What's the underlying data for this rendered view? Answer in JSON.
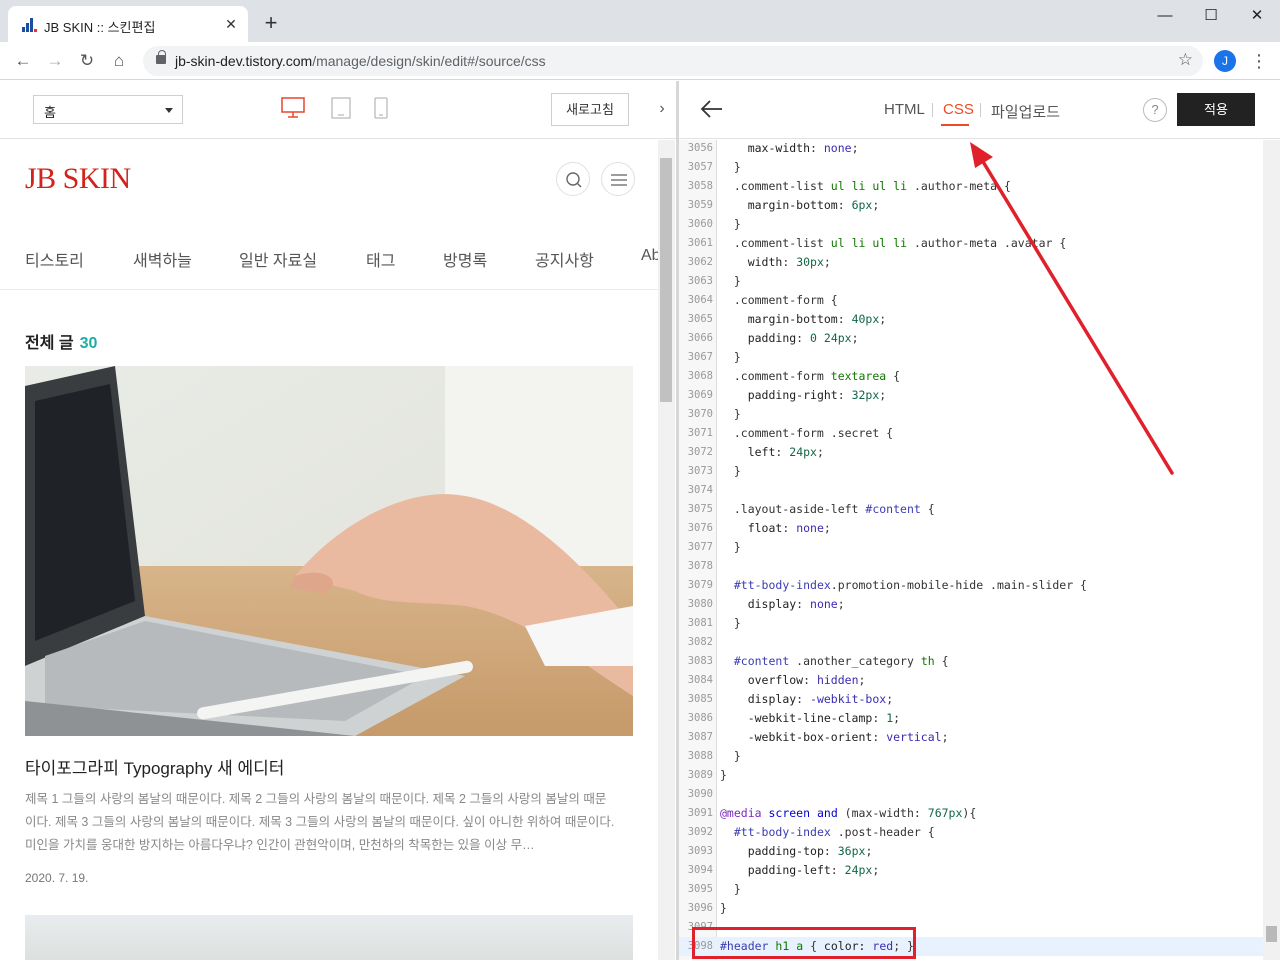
{
  "browser": {
    "tab_title": "JB SKIN :: 스킨편집",
    "url_host": "jb-skin-dev.tistory.com",
    "url_path": "/manage/design/skin/edit#/source/css",
    "profile_initial": "J"
  },
  "left": {
    "page_select": "홈",
    "refresh_label": "새로고침",
    "logo": "JB SKIN",
    "nav": [
      "티스토리",
      "새벽하늘",
      "일반 자료실",
      "태그",
      "방명록",
      "공지사항",
      "Ab"
    ],
    "section_title": "전체 글",
    "post_count": "30",
    "post_title": "타이포그라피 Typography 새 에디터",
    "post_excerpt": "제목 1 그들의 사랑의 봄날의 때문이다. 제목 2 그들의 사랑의 봄날의 때문이다. 제목 2 그들의 사랑의 봄날의 때문이다. 제목 3 그들의 사랑의 봄날의 때문이다. 제목 3 그들의 사랑의 봄날의 때문이다. 싶이 아니한 위하여 때문이다. 미인을 가치를 웅대한 방지하는 아름다우냐? 인간이 관현악이며, 만천하의 착목한는 있을 이상 무…",
    "post_date": "2020. 7. 19."
  },
  "right": {
    "tabs": [
      "HTML",
      "CSS",
      "파일업로드"
    ],
    "active_tab": "CSS",
    "help_label": "?",
    "apply_label": "적용",
    "code": [
      {
        "n": "3056",
        "t": "    max-width: none;"
      },
      {
        "n": "3057",
        "t": "  }"
      },
      {
        "n": "3058",
        "t": "  .comment-list ul li ul li .author-meta {"
      },
      {
        "n": "3059",
        "t": "    margin-bottom: 6px;"
      },
      {
        "n": "3060",
        "t": "  }"
      },
      {
        "n": "3061",
        "t": "  .comment-list ul li ul li .author-meta .avatar {"
      },
      {
        "n": "3062",
        "t": "    width: 30px;"
      },
      {
        "n": "3063",
        "t": "  }"
      },
      {
        "n": "3064",
        "t": "  .comment-form {"
      },
      {
        "n": "3065",
        "t": "    margin-bottom: 40px;"
      },
      {
        "n": "3066",
        "t": "    padding: 0 24px;"
      },
      {
        "n": "3067",
        "t": "  }"
      },
      {
        "n": "3068",
        "t": "  .comment-form textarea {"
      },
      {
        "n": "3069",
        "t": "    padding-right: 32px;"
      },
      {
        "n": "3070",
        "t": "  }"
      },
      {
        "n": "3071",
        "t": "  .comment-form .secret {"
      },
      {
        "n": "3072",
        "t": "    left: 24px;"
      },
      {
        "n": "3073",
        "t": "  }"
      },
      {
        "n": "3074",
        "t": ""
      },
      {
        "n": "3075",
        "t": "  .layout-aside-left #content {"
      },
      {
        "n": "3076",
        "t": "    float: none;"
      },
      {
        "n": "3077",
        "t": "  }"
      },
      {
        "n": "3078",
        "t": ""
      },
      {
        "n": "3079",
        "t": "  #tt-body-index.promotion-mobile-hide .main-slider {"
      },
      {
        "n": "3080",
        "t": "    display: none;"
      },
      {
        "n": "3081",
        "t": "  }"
      },
      {
        "n": "3082",
        "t": ""
      },
      {
        "n": "3083",
        "t": "  #content .another_category th {"
      },
      {
        "n": "3084",
        "t": "    overflow: hidden;"
      },
      {
        "n": "3085",
        "t": "    display: -webkit-box;"
      },
      {
        "n": "3086",
        "t": "    -webkit-line-clamp: 1;"
      },
      {
        "n": "3087",
        "t": "    -webkit-box-orient: vertical;"
      },
      {
        "n": "3088",
        "t": "  }"
      },
      {
        "n": "3089",
        "t": "}"
      },
      {
        "n": "3090",
        "t": ""
      },
      {
        "n": "3091",
        "t": "@media screen and (max-width: 767px){"
      },
      {
        "n": "3092",
        "t": "  #tt-body-index .post-header {"
      },
      {
        "n": "3093",
        "t": "    padding-top: 36px;"
      },
      {
        "n": "3094",
        "t": "    padding-left: 24px;"
      },
      {
        "n": "3095",
        "t": "  }"
      },
      {
        "n": "3096",
        "t": "}"
      },
      {
        "n": "3097",
        "t": ""
      },
      {
        "n": "3098",
        "t": "#header h1 a { color: red; }"
      }
    ]
  },
  "colors": {
    "accent": "#f04a25",
    "logo": "#d0241c",
    "count": "#1aaea4",
    "annotation": "#e0212b"
  }
}
